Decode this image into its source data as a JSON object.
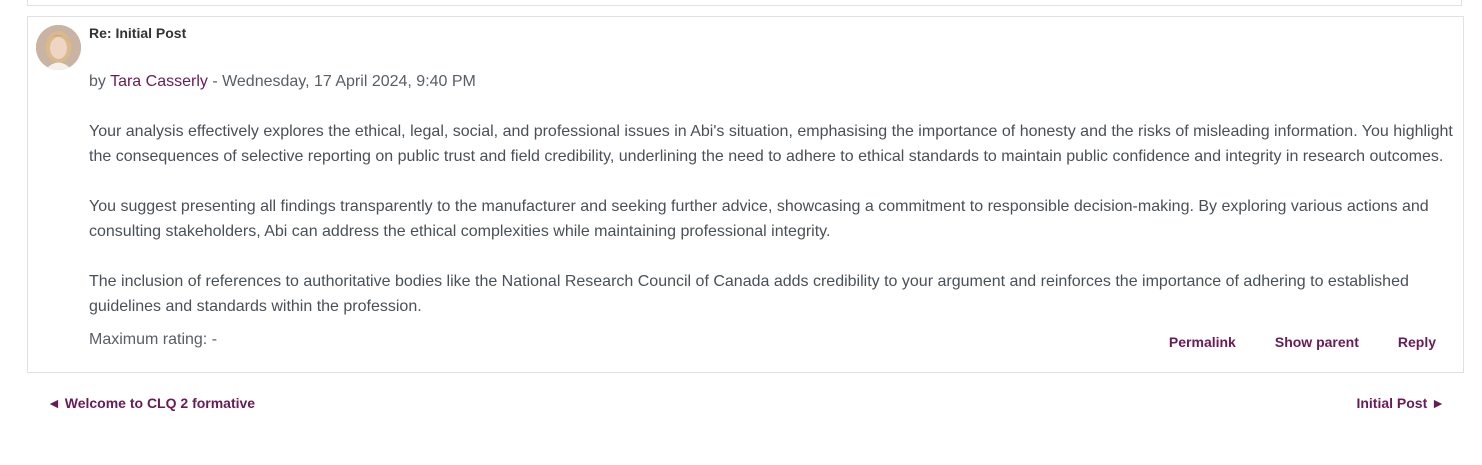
{
  "post": {
    "subject": "Re: Initial Post",
    "by_prefix": "by",
    "author": "Tara Casserly",
    "date": " - Wednesday, 17 April 2024, 9:40 PM",
    "paragraphs": [
      "Your analysis effectively explores the ethical, legal, social, and professional issues in Abi's situation, emphasising the importance of honesty and the risks of misleading information. You highlight the consequences of selective reporting on public trust and field credibility, underlining the need to adhere to ethical standards to maintain public confidence and integrity in research outcomes.",
      "You suggest presenting all findings transparently to the manufacturer and seeking further advice, showcasing a commitment to responsible decision-making. By exploring various actions and consulting stakeholders, Abi can address the ethical complexities while maintaining professional integrity.",
      "The inclusion of references to authoritative bodies like the National Research Council of Canada adds credibility to your argument and reinforces the importance of adhering to established guidelines and standards within the profession."
    ],
    "rating": "Maximum rating: -",
    "actions": {
      "permalink": "Permalink",
      "show_parent": "Show parent",
      "reply": "Reply"
    }
  },
  "navigation": {
    "prev": "◄ Welcome to CLQ 2 formative",
    "next": "Initial Post ►"
  },
  "colors": {
    "link": "#6a1a55",
    "text": "#495057",
    "border": "#dee2e6"
  }
}
